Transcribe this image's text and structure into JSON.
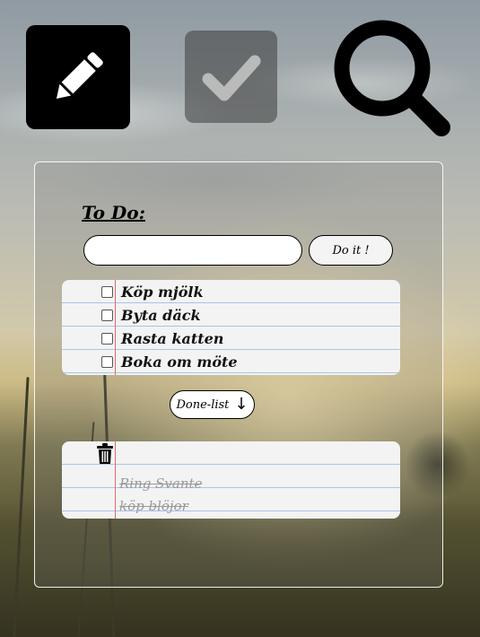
{
  "toolbar": {
    "edit_icon": "pencil-icon",
    "done_icon": "checkmark-icon",
    "search_icon": "magnifier-icon"
  },
  "todo": {
    "title": "To Do:",
    "input_value": "",
    "submit_label": "Do it !",
    "items": [
      {
        "label": "Köp mjölk",
        "checked": false
      },
      {
        "label": "Byta däck",
        "checked": false
      },
      {
        "label": "Rasta katten",
        "checked": false
      },
      {
        "label": "Boka om möte",
        "checked": false
      }
    ]
  },
  "done_list": {
    "toggle_label": "Done-list",
    "toggle_arrow": "↓",
    "trash_icon": "trash-icon",
    "items": [
      {
        "label": "Ring Svante"
      },
      {
        "label": "köp blöjor"
      }
    ]
  },
  "colors": {
    "paper_line": "#a9c4ea",
    "paper_margin": "#e06a6a",
    "done_text": "#999999"
  }
}
